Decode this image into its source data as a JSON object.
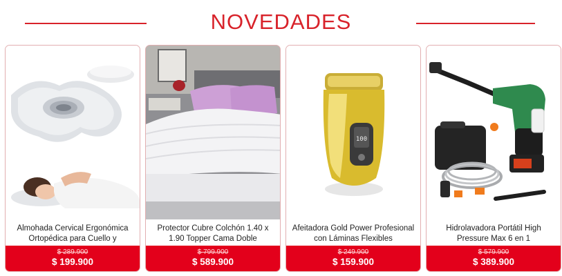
{
  "section": {
    "title": "NOVEDADES"
  },
  "products": [
    {
      "name": "Almohada Cervical Ergonómica Ortopédica para Cuello y",
      "old_price": "$ 289.900",
      "price": "$ 199.900",
      "image_icon": "cervical-pillow-image"
    },
    {
      "name": "Protector Cubre Colchón 1.40 x 1.90 Topper Cama Doble",
      "old_price": "$ 799.900",
      "price": "$ 589.900",
      "image_icon": "mattress-topper-image"
    },
    {
      "name": "Afeitadora Gold Power Profesional con Láminas Flexibles",
      "old_price": "$ 249.900",
      "price": "$ 159.900",
      "image_icon": "gold-shaver-image"
    },
    {
      "name": "Hidrolavadora Portátil High Pressure Max 6 en 1",
      "old_price": "$ 579.900",
      "price": "$ 389.900",
      "image_icon": "pressure-washer-image"
    }
  ],
  "colors": {
    "accent": "#d8222a",
    "price_bar": "#e3001b"
  }
}
